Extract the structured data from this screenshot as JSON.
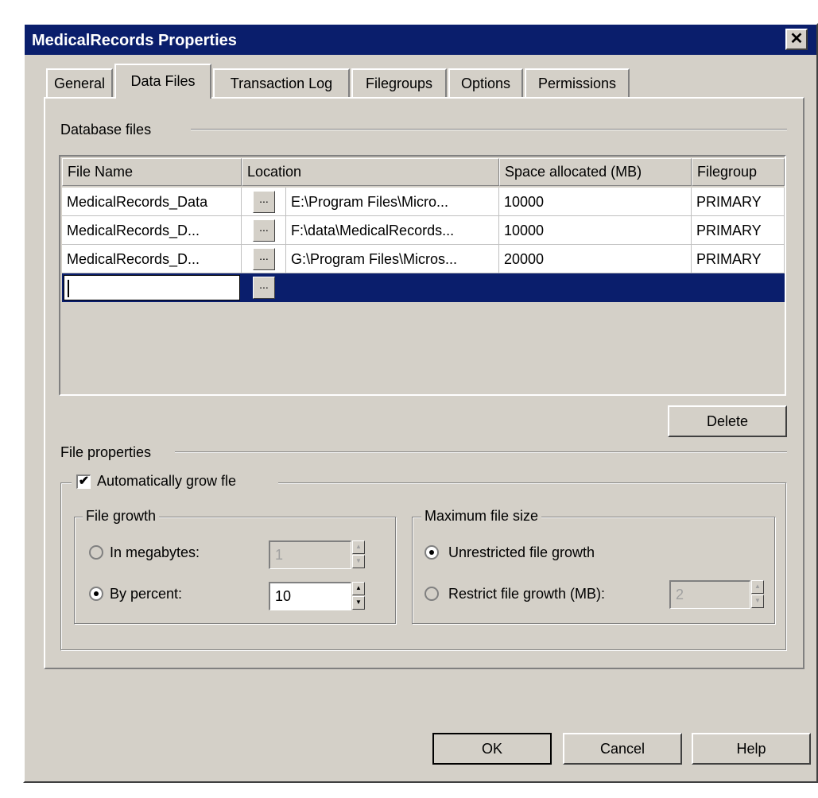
{
  "window": {
    "title": "MedicalRecords Properties",
    "close_glyph": "✕"
  },
  "tabs": [
    {
      "label": "General"
    },
    {
      "label": "Data Files"
    },
    {
      "label": "Transaction Log"
    },
    {
      "label": "Filegroups"
    },
    {
      "label": "Options"
    },
    {
      "label": "Permissions"
    }
  ],
  "database_files": {
    "group_label": "Database files",
    "columns": {
      "file_name": "File Name",
      "location": "Location",
      "space": "Space allocated (MB)",
      "filegroup": "Filegroup"
    },
    "rows": [
      {
        "file_name": "MedicalRecords_Data",
        "location": "E:\\Program Files\\Micro...",
        "space": "10000",
        "filegroup": "PRIMARY"
      },
      {
        "file_name": "MedicalRecords_D...",
        "location": "F:\\data\\MedicalRecords...",
        "space": "10000",
        "filegroup": "PRIMARY"
      },
      {
        "file_name": "MedicalRecords_D...",
        "location": "G:\\Program Files\\Micros...",
        "space": "20000",
        "filegroup": "PRIMARY"
      }
    ],
    "ellipsis": "...",
    "delete_label": "Delete"
  },
  "file_properties": {
    "group_label": "File properties",
    "auto_grow_label": "Automatically grow fle",
    "auto_grow_checked": true,
    "check_glyph": "✔",
    "file_growth": {
      "label": "File growth",
      "megabytes_label": "In megabytes:",
      "megabytes_value": "1",
      "percent_label": "By percent:",
      "percent_value": "10",
      "selected": "percent"
    },
    "max_size": {
      "label": "Maximum file size",
      "unrestricted_label": "Unrestricted file growth",
      "restrict_label": "Restrict file growth (MB):",
      "restrict_value": "2",
      "selected": "unrestricted"
    },
    "spin_up": "▲",
    "spin_down": "▼"
  },
  "buttons": {
    "ok": "OK",
    "cancel": "Cancel",
    "help": "Help"
  }
}
